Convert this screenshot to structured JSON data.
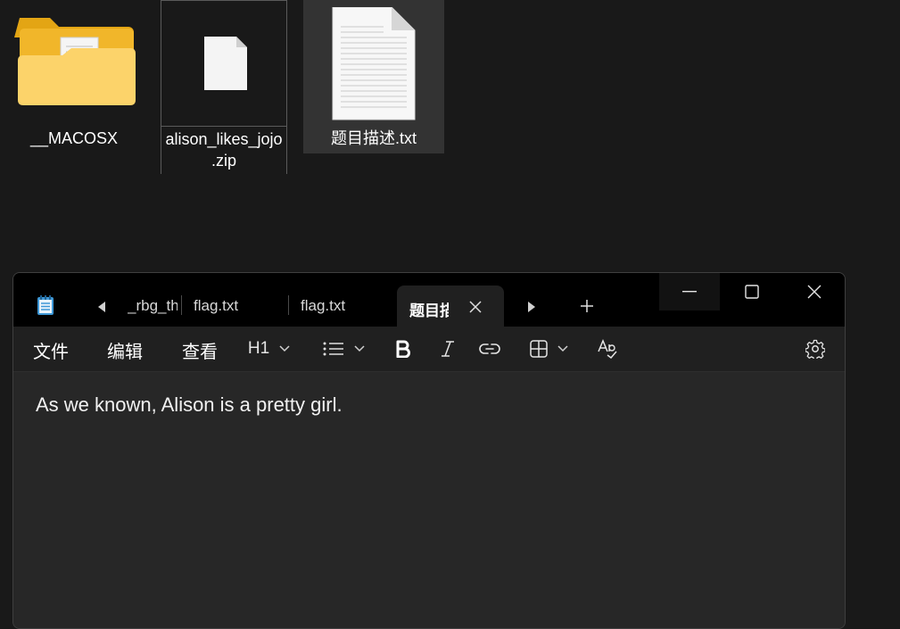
{
  "desktop": {
    "items": [
      {
        "name": "__MACOSX",
        "type": "folder"
      },
      {
        "name_line1": "alison_likes_jojo",
        "name_line2": ".zip",
        "type": "zip"
      },
      {
        "name": "题目描述.txt",
        "type": "text-file"
      }
    ]
  },
  "window": {
    "app_icon": "notepad-icon",
    "tabs": [
      {
        "label": "_rbg_th"
      },
      {
        "label": "flag.txt"
      },
      {
        "label": "flag.txt"
      },
      {
        "label": "题目描述.txt",
        "active": true
      }
    ],
    "controls": [
      "minimize-icon",
      "maximize-icon",
      "close-icon"
    ]
  },
  "menu": {
    "file": "文件",
    "edit": "编辑",
    "view": "查看",
    "heading": "H1"
  },
  "document": {
    "text": "As we known, Alison is a pretty girl."
  },
  "colors": {
    "desktop_bg": "#191919",
    "titlebar_bg": "#000000",
    "toolbar_bg": "#202020",
    "editor_bg": "#272727",
    "selection_bg": "#333333"
  }
}
